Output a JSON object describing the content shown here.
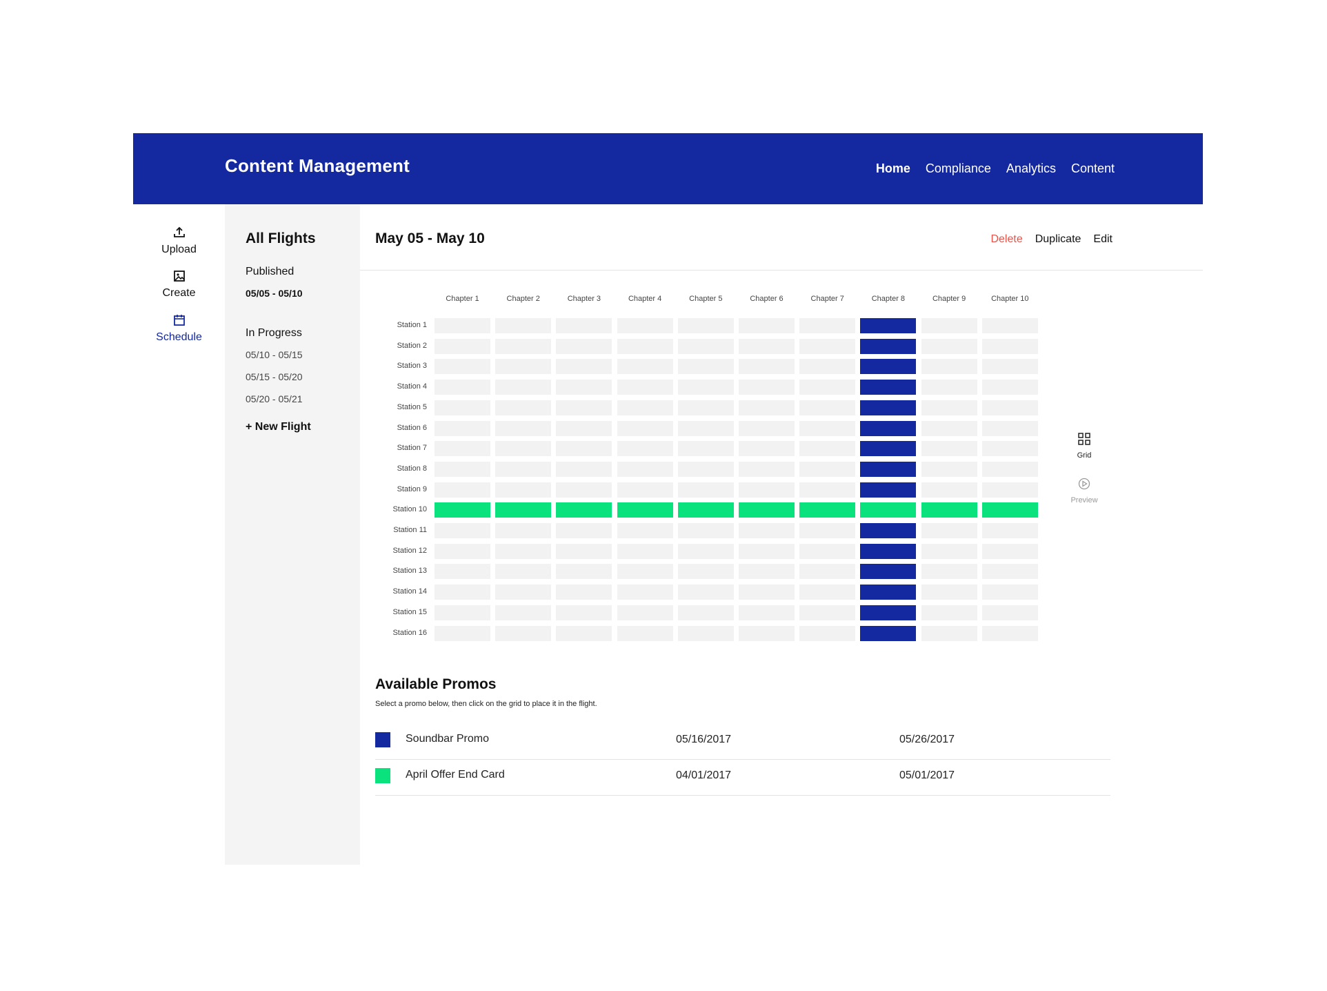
{
  "app": {
    "title": "Content Management"
  },
  "topnav": [
    {
      "label": "Home",
      "active": true
    },
    {
      "label": "Compliance",
      "active": false
    },
    {
      "label": "Analytics",
      "active": false
    },
    {
      "label": "Content",
      "active": false
    }
  ],
  "rail": [
    {
      "label": "Upload",
      "icon": "upload-icon",
      "active": false
    },
    {
      "label": "Create",
      "icon": "image-icon",
      "active": false
    },
    {
      "label": "Schedule",
      "icon": "calendar-icon",
      "active": true
    }
  ],
  "flights": {
    "header": "All Flights",
    "published_label": "Published",
    "published": [
      "05/05 - 05/10"
    ],
    "in_progress_label": "In Progress",
    "in_progress": [
      "05/10 - 05/15",
      "05/15 - 05/20",
      "05/20 - 05/21"
    ],
    "new_flight": "+ New Flight"
  },
  "main": {
    "title": "May 05 - May 10",
    "actions": {
      "delete": "Delete",
      "duplicate": "Duplicate",
      "edit": "Edit"
    }
  },
  "grid": {
    "chapters": [
      "Chapter 1",
      "Chapter 2",
      "Chapter 3",
      "Chapter 4",
      "Chapter 5",
      "Chapter 6",
      "Chapter 7",
      "Chapter 8",
      "Chapter 9",
      "Chapter 10"
    ],
    "stations": [
      "Station 1",
      "Station 2",
      "Station 3",
      "Station 4",
      "Station 5",
      "Station 6",
      "Station 7",
      "Station 8",
      "Station 9",
      "Station 10",
      "Station 11",
      "Station 12",
      "Station 13",
      "Station 14",
      "Station 15",
      "Station 16"
    ],
    "blue_column": "Chapter 8",
    "green_row": "Station 10",
    "colors": {
      "empty": "#f2f2f2",
      "blue": "#1428a0",
      "green": "#0ae37d"
    }
  },
  "view": {
    "grid_label": "Grid",
    "preview_label": "Preview"
  },
  "promos": {
    "title": "Available Promos",
    "subtitle": "Select a promo below, then click on the grid to place it in the flight.",
    "items": [
      {
        "name": "Soundbar Promo",
        "start": "05/16/2017",
        "end": "05/26/2017",
        "color": "#1428a0"
      },
      {
        "name": "April Offer End Card",
        "start": "04/01/2017",
        "end": "05/01/2017",
        "color": "#0ae37d"
      }
    ]
  },
  "colors": {
    "brand": "#1428a0",
    "accent_green": "#0ae37d",
    "danger": "#e8534a"
  }
}
